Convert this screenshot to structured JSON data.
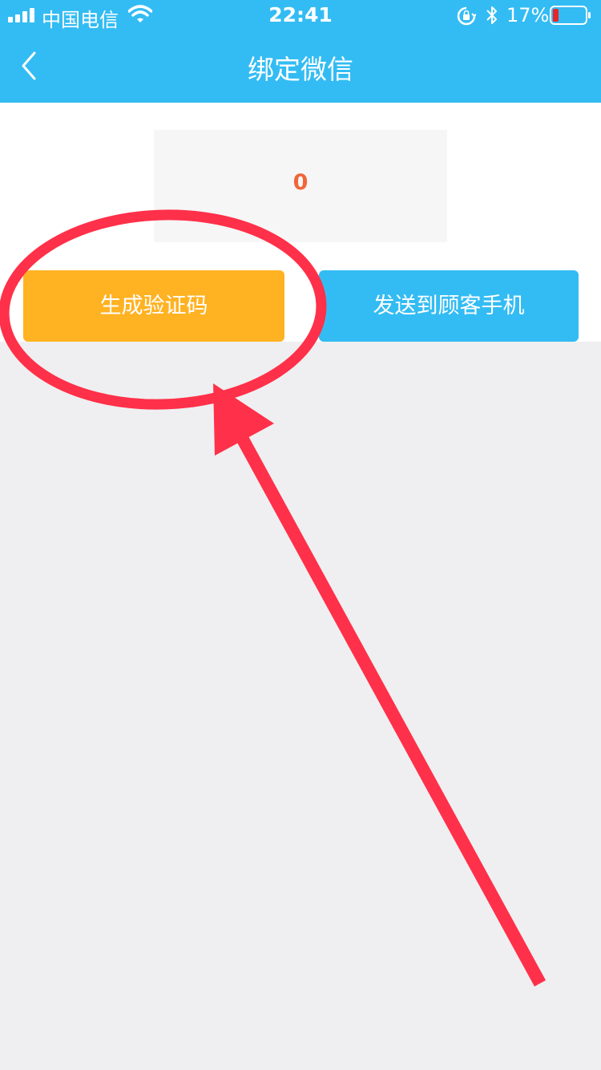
{
  "status_bar": {
    "carrier": "中国电信",
    "time": "22:41",
    "battery_percent": "17%",
    "battery_level": 0.17,
    "icons": [
      "signal-icon",
      "wifi-icon",
      "orientation-lock-icon",
      "bluetooth-icon",
      "battery-icon"
    ]
  },
  "nav": {
    "title": "绑定微信",
    "back_icon": "chevron-left-icon"
  },
  "code_display": {
    "value": "0"
  },
  "actions": {
    "generate_label": "生成验证码",
    "send_label": "发送到顾客手机"
  },
  "colors": {
    "header": "#33bcf3",
    "generate_button": "#ffb222",
    "send_button": "#33bcf3",
    "code_text": "#f0663a",
    "annotation": "#ff3049",
    "page_background": "#efeff1"
  }
}
